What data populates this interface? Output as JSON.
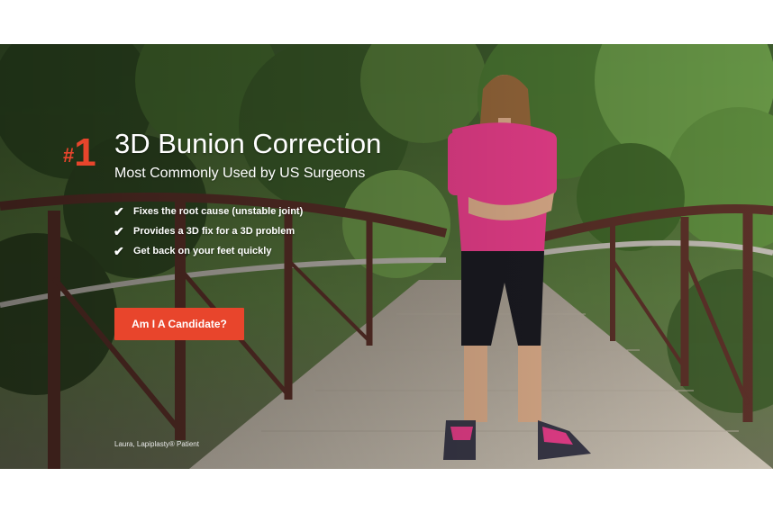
{
  "hero": {
    "rank_hash": "#",
    "rank_number": "1",
    "headline": "3D Bunion Correction",
    "subheadline": "Most Commonly Used by US Surgeons",
    "benefits": [
      {
        "icon": "checkmark-icon",
        "text": "Fixes the root cause (unstable joint)"
      },
      {
        "icon": "checkmark-icon",
        "text": "Provides a 3D fix for a 3D problem"
      },
      {
        "icon": "checkmark-icon",
        "text": "Get back on your feet quickly"
      }
    ],
    "check_glyph": "✔",
    "cta_label": "Am I A Candidate?",
    "caption": "Laura, Lapiplasty® Patient",
    "colors": {
      "accent": "#e8452c",
      "shirt": "#f0408f",
      "text": "#ffffff"
    }
  }
}
